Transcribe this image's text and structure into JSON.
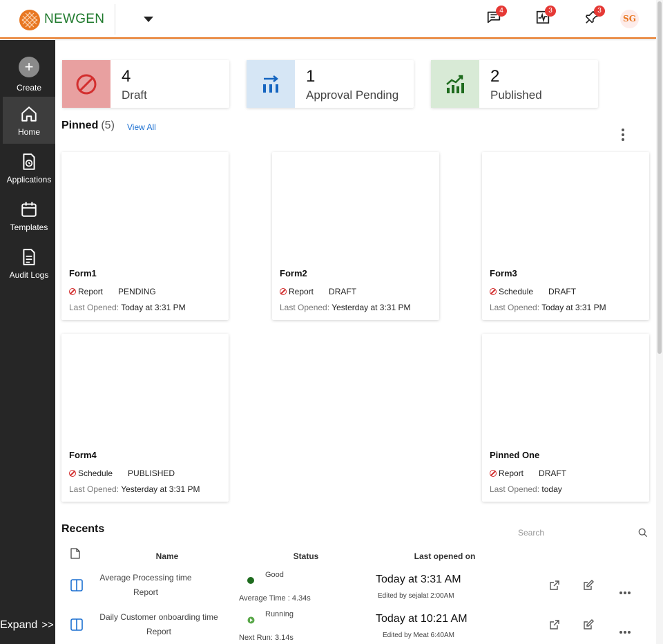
{
  "header": {
    "brand": "NEWGEN",
    "messages_badge": "4",
    "activity_badge": "3",
    "pins_badge": "3",
    "avatar_initials": "SG"
  },
  "sidebar": {
    "items": [
      {
        "label": "Create",
        "icon": "plus-circle-icon"
      },
      {
        "label": "Home",
        "icon": "home-icon"
      },
      {
        "label": "Applications",
        "icon": "document-clock-icon"
      },
      {
        "label": "Templates",
        "icon": "calendar-icon"
      },
      {
        "label": "Audit Logs",
        "icon": "document-lines-icon"
      }
    ],
    "expand_label": "Expand",
    "expand_chevron": ">>"
  },
  "stats": [
    {
      "count": "4",
      "label": "Draft",
      "color": "#e8a0a0",
      "icon": "ban-icon"
    },
    {
      "count": "1",
      "label": "Approval Pending",
      "color": "#d6e6f5",
      "icon": "arrow-bars-icon"
    },
    {
      "count": "2",
      "label": "Published",
      "color": "#d8ead6",
      "icon": "trend-up-icon"
    }
  ],
  "pinned": {
    "title": "Pinned",
    "count": "(5)",
    "view_all": "View All",
    "cards": [
      {
        "name": "Form1",
        "type": "Report",
        "status": "PENDING",
        "last_label": "Last Opened:",
        "last_value": "Today at 3:31 PM"
      },
      {
        "name": "Form2",
        "type": "Report",
        "status": "DRAFT",
        "last_label": "Last Opened:",
        "last_value": "Yesterday at 3:31 PM"
      },
      {
        "name": "Form3",
        "type": "Schedule",
        "status": "DRAFT",
        "last_label": "Last Opened:",
        "last_value": "Today at 3:31 PM"
      },
      {
        "name": "Form4",
        "type": "Schedule",
        "status": "PUBLISHED",
        "last_label": "Last Opened:",
        "last_value": "Yesterday at 3:31 PM"
      },
      {
        "name": "Pinned One",
        "type": "Report",
        "status": "DRAFT",
        "last_label": "Last Opened:",
        "last_value": "today"
      }
    ]
  },
  "recents": {
    "title": "Recents",
    "search_placeholder": "Search",
    "columns": {
      "name": "Name",
      "status": "Status",
      "last_opened": "Last opened on"
    },
    "rows": [
      {
        "name_line1": "Average Processing time",
        "name_line2": "Report",
        "status": "Good",
        "status_color": "#1e6b1e",
        "status_sub": "Average Time : 4.34s",
        "opened": "Today at 3:31 AM",
        "edited": "Edited by sejalat 2:00AM"
      },
      {
        "name_line1": "Daily Customer onboarding time",
        "name_line2": "Report",
        "status": "Running",
        "status_color": "#5aa84a",
        "status_sub": "Next Run: 3.14s",
        "opened": "Today at 10:21 AM",
        "edited": "Edited by Meat 6:40AM"
      }
    ]
  }
}
